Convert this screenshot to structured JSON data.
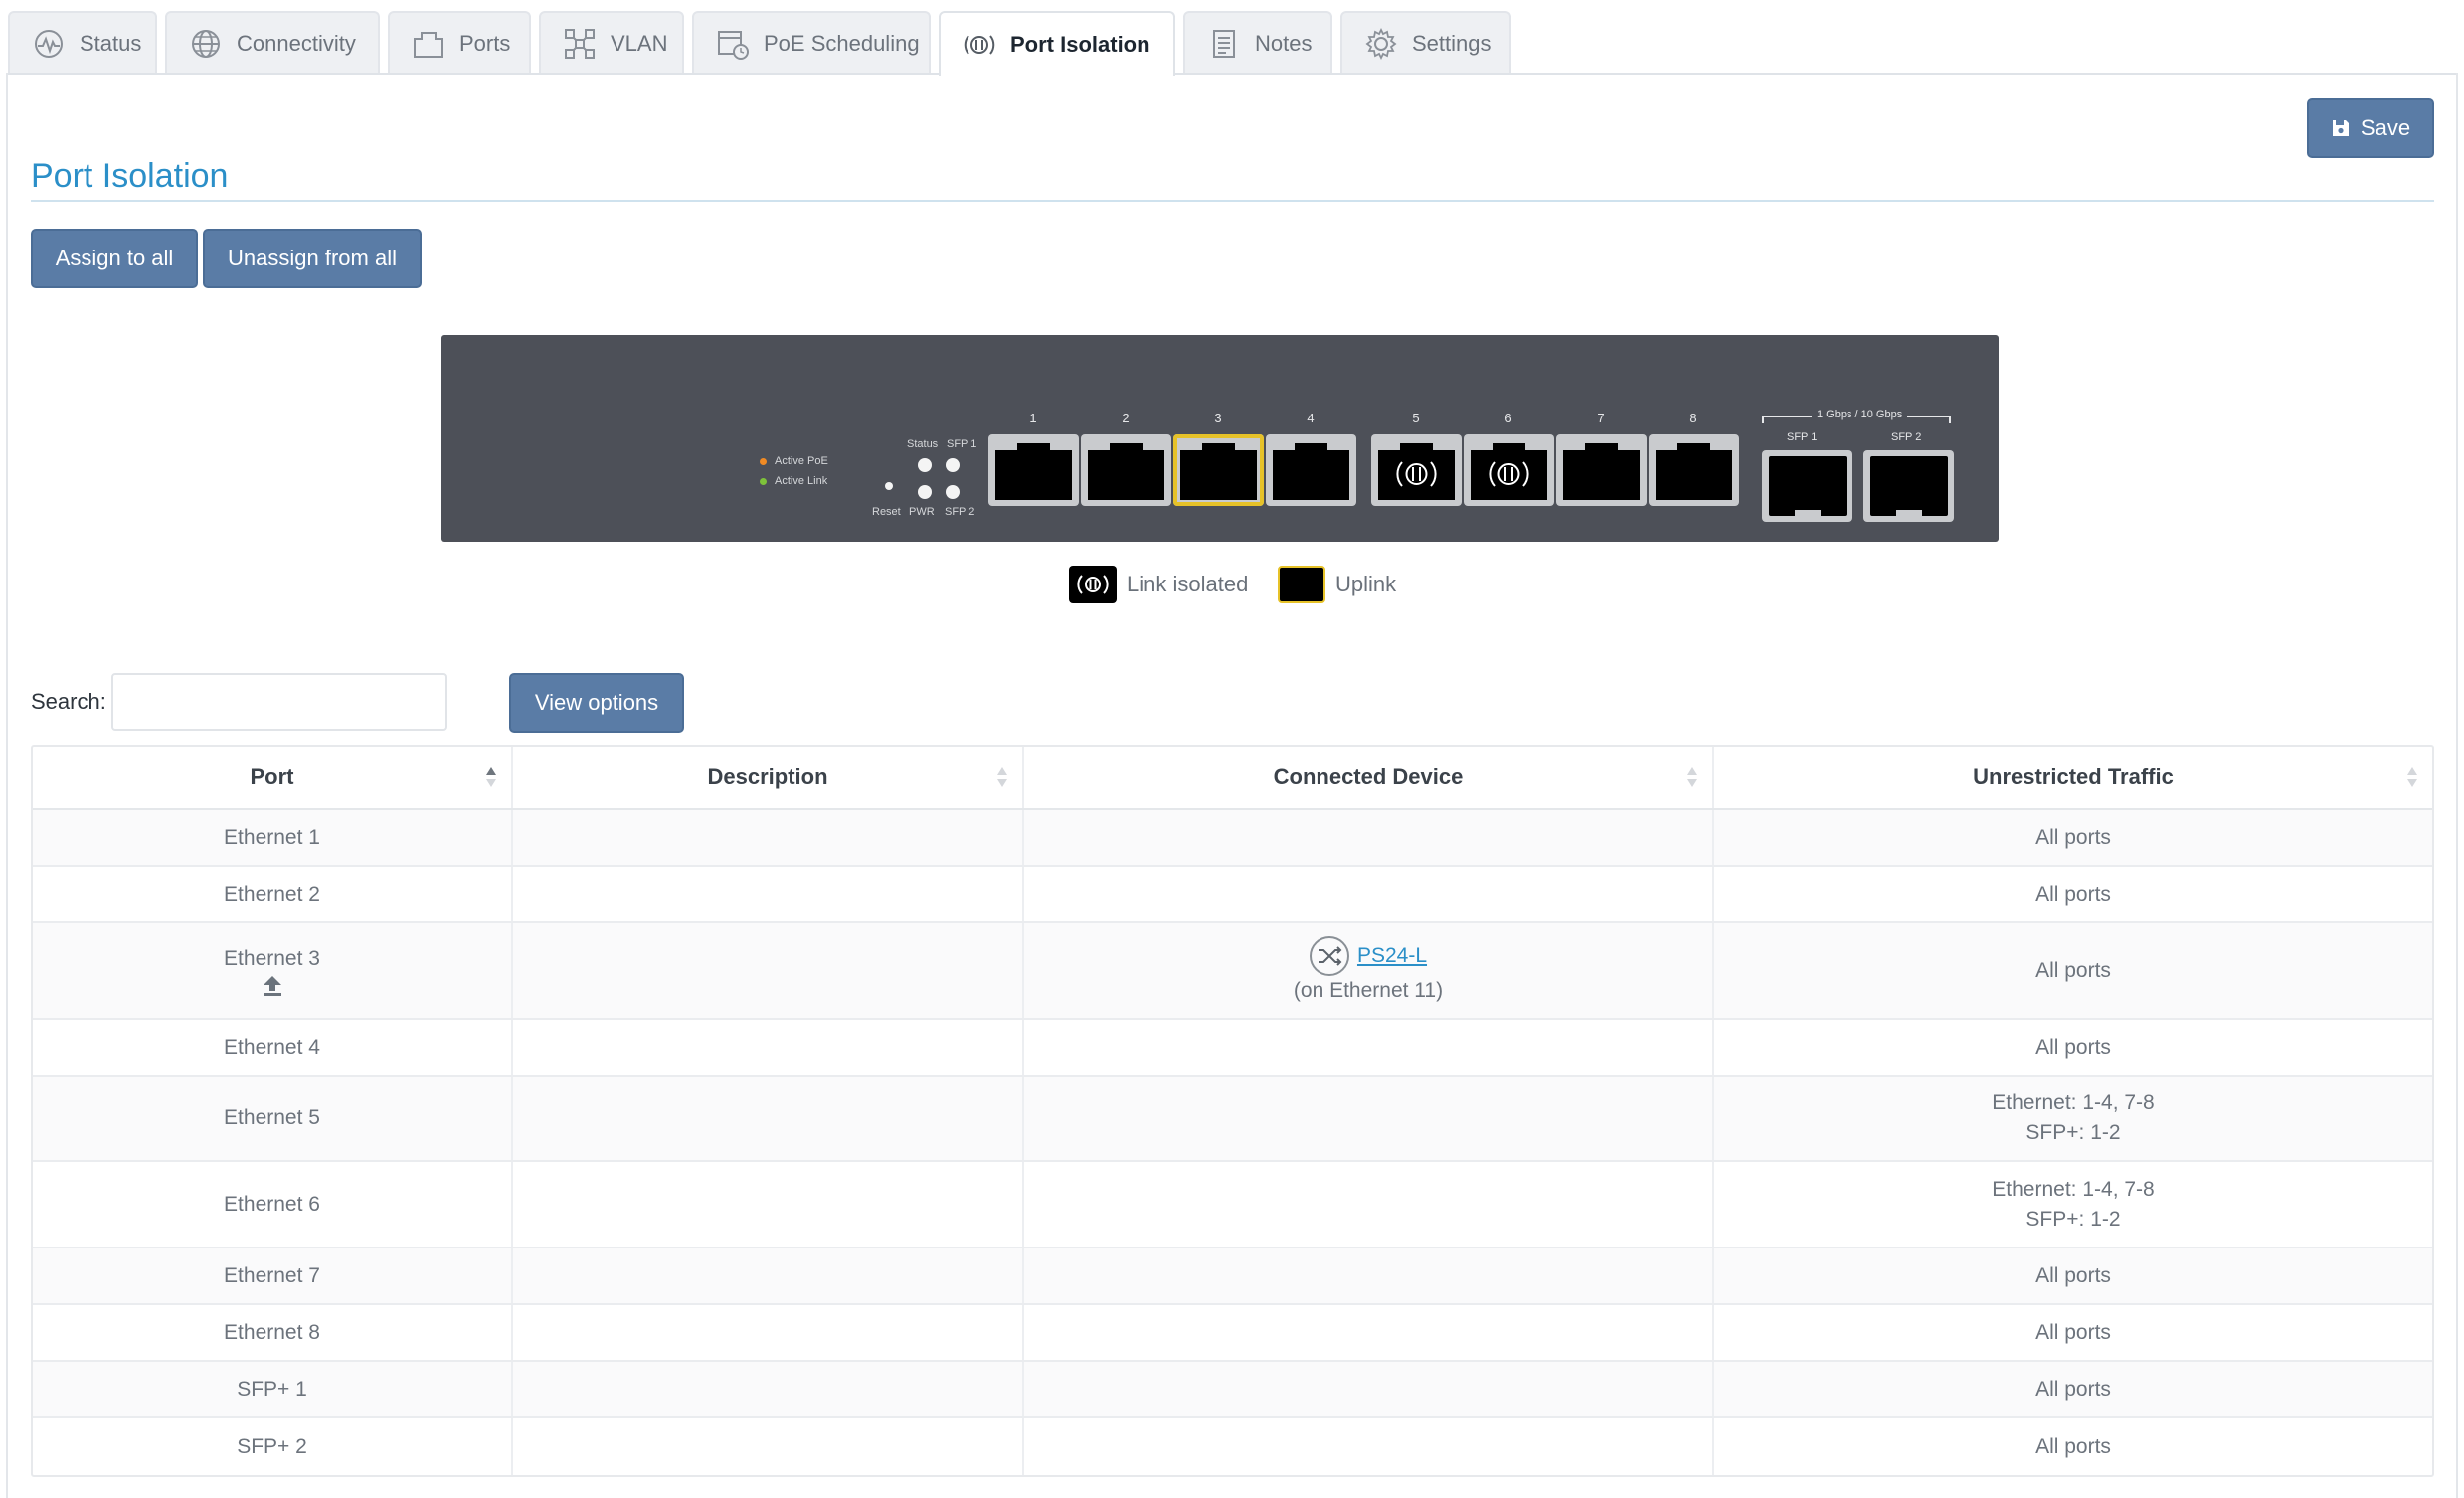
{
  "tabs": [
    {
      "label": "Status",
      "icon": "status-pulse-icon",
      "active": false
    },
    {
      "label": "Connectivity",
      "icon": "globe-icon",
      "active": false
    },
    {
      "label": "Ports",
      "icon": "ports-icon",
      "active": false
    },
    {
      "label": "VLAN",
      "icon": "vlan-icon",
      "active": false
    },
    {
      "label": "PoE Scheduling",
      "icon": "calendar-clock-icon",
      "active": false
    },
    {
      "label": "Port Isolation",
      "icon": "isolation-icon",
      "active": true
    },
    {
      "label": "Notes",
      "icon": "notes-icon",
      "active": false
    },
    {
      "label": "Settings",
      "icon": "gear-icon",
      "active": false
    }
  ],
  "toolbar": {
    "save_label": "Save"
  },
  "page": {
    "title": "Port Isolation"
  },
  "actions": {
    "assign_all": "Assign to all",
    "unassign_all": "Unassign from all"
  },
  "switch_panel": {
    "led_legend": {
      "active_poe": "Active PoE",
      "active_link": "Active Link"
    },
    "labels": {
      "status": "Status",
      "sfp1_top": "SFP 1",
      "reset": "Reset",
      "pwr": "PWR",
      "sfp2_bottom": "SFP 2"
    },
    "ports": [
      "1",
      "2",
      "3",
      "4",
      "5",
      "6",
      "7",
      "8"
    ],
    "sfp_speed": "1 Gbps / 10 Gbps",
    "sfp_ports": [
      "SFP 1",
      "SFP 2"
    ],
    "colors": {
      "poe_led": "#f08a24",
      "link_led": "#7ec23a",
      "uplink": "#e6c229",
      "panel": "#4d5058"
    }
  },
  "legend": {
    "isolated": "Link isolated",
    "uplink": "Uplink"
  },
  "search": {
    "label": "Search:",
    "value": ""
  },
  "view_options": "View options",
  "table": {
    "headers": [
      "Port",
      "Description",
      "Connected Device",
      "Unrestricted Traffic"
    ],
    "rows": [
      {
        "port": "Ethernet 1",
        "description": "",
        "traffic": [
          "All ports"
        ]
      },
      {
        "port": "Ethernet 2",
        "description": "",
        "traffic": [
          "All ports"
        ]
      },
      {
        "port": "Ethernet 3",
        "description": "",
        "device_name": "PS24-L",
        "device_sub": "(on Ethernet 11)",
        "traffic": [
          "All ports"
        ],
        "uplink": true
      },
      {
        "port": "Ethernet 4",
        "description": "",
        "traffic": [
          "All ports"
        ]
      },
      {
        "port": "Ethernet 5",
        "description": "",
        "traffic": [
          "Ethernet: 1-4, 7-8",
          "SFP+: 1-2"
        ]
      },
      {
        "port": "Ethernet 6",
        "description": "",
        "traffic": [
          "Ethernet: 1-4, 7-8",
          "SFP+: 1-2"
        ]
      },
      {
        "port": "Ethernet 7",
        "description": "",
        "traffic": [
          "All ports"
        ]
      },
      {
        "port": "Ethernet 8",
        "description": "",
        "traffic": [
          "All ports"
        ]
      },
      {
        "port": "SFP+ 1",
        "description": "",
        "traffic": [
          "All ports"
        ]
      },
      {
        "port": "SFP+ 2",
        "description": "",
        "traffic": [
          "All ports"
        ]
      }
    ]
  }
}
